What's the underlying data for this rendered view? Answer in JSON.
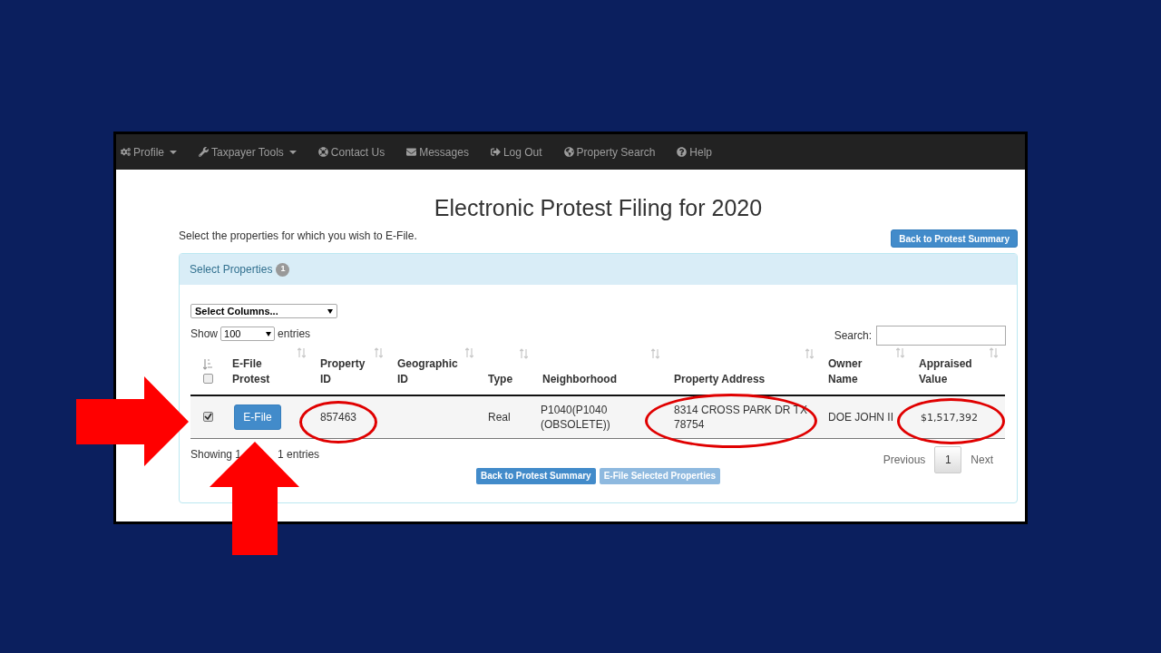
{
  "navbar": {
    "items": [
      {
        "label": "Profile",
        "dropdown": true
      },
      {
        "label": "Taxpayer Tools",
        "dropdown": true
      },
      {
        "label": "Contact Us",
        "dropdown": false
      },
      {
        "label": "Messages",
        "dropdown": false
      },
      {
        "label": "Log Out",
        "dropdown": false
      },
      {
        "label": "Property Search",
        "dropdown": false
      },
      {
        "label": "Help",
        "dropdown": false
      }
    ]
  },
  "title": "Electronic Protest Filing for 2020",
  "instructions": "Select the properties for which you wish to E-File.",
  "top_button": "Back to Protest Summary",
  "panel": {
    "heading": "Select Properties",
    "badge": "1",
    "column_select": "Select Columns...",
    "show_label": "Show",
    "page_size": "100",
    "entries_label": "entries",
    "search_label": "Search:",
    "select_all_checked": false,
    "columns": [
      [
        "E-File",
        "Protest"
      ],
      [
        "Property",
        "ID"
      ],
      [
        "Geographic",
        "ID"
      ],
      [
        "Type"
      ],
      [
        "Neighborhood"
      ],
      [
        "Property Address"
      ],
      [
        "Owner",
        "Name"
      ],
      [
        "Appraised",
        "Value"
      ]
    ],
    "rows": [
      {
        "checked": true,
        "action": "E-File",
        "property_id": "857463",
        "geographic_id": "",
        "type": "Real",
        "neighborhood": [
          "P1040(P1040",
          "(OBSOLETE))"
        ],
        "address": [
          "8314 CROSS PARK DR TX",
          "78754"
        ],
        "owner": "DOE JOHN II",
        "value": "$1,517,392"
      }
    ],
    "info_start": "Showing 1",
    "info_end": "1 entries",
    "pagination": [
      {
        "label": "Previous",
        "selected": false
      },
      {
        "label": "1",
        "selected": true
      },
      {
        "label": "Next",
        "selected": false
      }
    ],
    "buttons": [
      {
        "label": "Back to Protest Summary",
        "disabled": false
      },
      {
        "label": "E-File Selected Properties",
        "disabled": true
      }
    ]
  }
}
